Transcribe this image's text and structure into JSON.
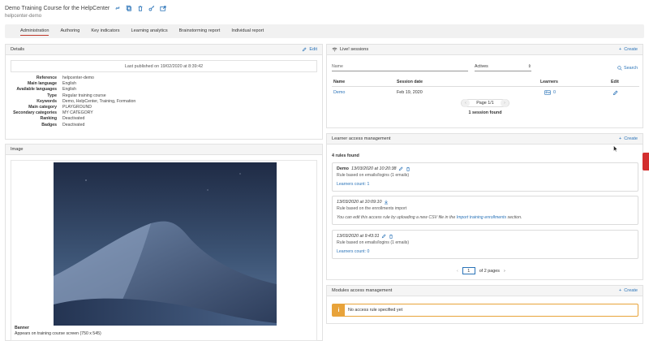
{
  "header": {
    "title": "Demo Training Course for the HelpCenter",
    "subtitle": "helpcenter-demo",
    "icons": [
      "link-icon",
      "copy-icon",
      "trash-icon",
      "key-icon",
      "share-icon"
    ]
  },
  "tabs": [
    {
      "label": "Administration",
      "active": true
    },
    {
      "label": "Authoring"
    },
    {
      "label": "Key indicators"
    },
    {
      "label": "Learning analytics"
    },
    {
      "label": "Brainstorming report"
    },
    {
      "label": "Individual report"
    }
  ],
  "details": {
    "title": "Details",
    "edit_label": "Edit",
    "published": "Last published on 19/02/2020 at 8:39:42",
    "rows": [
      {
        "k": "Reference",
        "v": "helpcenter-demo"
      },
      {
        "k": "Main language",
        "v": "English"
      },
      {
        "k": "Available languages",
        "v": "English"
      },
      {
        "k": "Type",
        "v": "Regular training course"
      },
      {
        "k": "Keywords",
        "v": "Demo, HelpCenter, Training, Formation"
      },
      {
        "k": "Main category",
        "v": "PLAYGROUND"
      },
      {
        "k": "Secondary categories",
        "v": "MY CATEGORY"
      },
      {
        "k": "Ranking",
        "v": "Deactivated"
      },
      {
        "k": "Badges",
        "v": "Deactivated"
      }
    ]
  },
  "image": {
    "title": "Image",
    "banner_title": "Banner",
    "banner_desc": "Appears on training course screen (750 x 545)"
  },
  "sessions": {
    "title": "Live! sessions",
    "create_label": "Create",
    "name_placeholder": "Name",
    "select_value": "Actives",
    "search_label": "Search",
    "columns": [
      "Name",
      "Session date",
      "Learners",
      "Edit"
    ],
    "row": {
      "name": "Demo",
      "date": "Feb 19, 2020",
      "learners": "0"
    },
    "page": "Page 1/1",
    "found": "1 session found"
  },
  "learner_access": {
    "title": "Learner access management",
    "create_label": "Create",
    "count": "4 rules found",
    "cards": [
      {
        "bold": "Demo",
        "date": "13/03/2020 at 10:20:38",
        "line2": "Rule based on emails/logins (1 emails)",
        "link": "Learners count: 1"
      },
      {
        "bold": "",
        "date": "13/03/2020 at 10:09:10",
        "line2": "Rule based on the enrollments import",
        "line3a": "You can edit this access rule by uploading a new CSV file in the ",
        "line3link": "Import training enrollments",
        "line3b": " section."
      },
      {
        "bold": "",
        "date": "13/03/2020 at 9:43:31",
        "line2": "Rule based on emails/logins (1 emails)",
        "link": "Learners count: 0"
      }
    ],
    "page_value": "1",
    "pages_text": "of 2 pages"
  },
  "modules_access": {
    "title": "Modules access management",
    "create_label": "Create",
    "warning": "No access rule specified yet"
  },
  "colors": {
    "accent": "#2a73b8",
    "tab_underline": "#c0392b",
    "warning": "#e8a33a",
    "side_tab": "#d32f2f"
  }
}
